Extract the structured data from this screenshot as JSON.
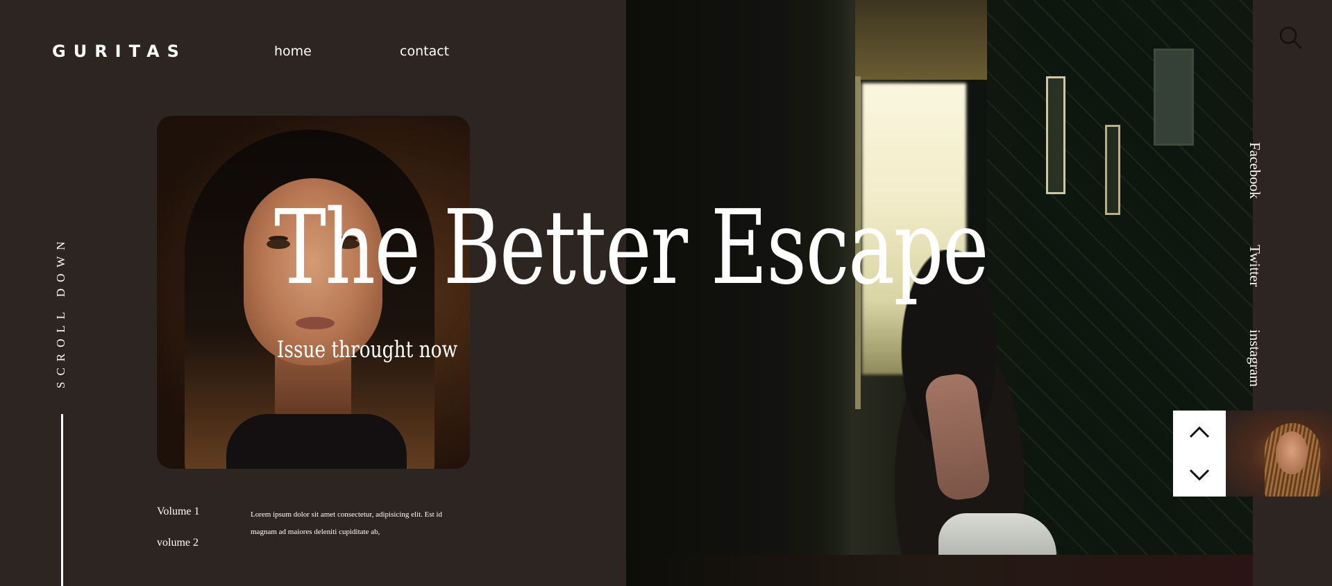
{
  "header": {
    "logo": "GURITAS",
    "nav": [
      {
        "label": "home"
      },
      {
        "label": "contact"
      }
    ]
  },
  "hero": {
    "title": "The Better Escape",
    "subtitle": "Issue throught now"
  },
  "scroll": {
    "label": "SCROLL DOWN"
  },
  "volumes": [
    {
      "label": "Volume 1"
    },
    {
      "label": "volume 2"
    }
  ],
  "description": "Lorem ipsum dolor sit amet consectetur, adipisicing elit. Est id magnam ad maiores deleniti cupiditate ab,",
  "social": [
    {
      "label": "Facebook"
    },
    {
      "label": "Twitter"
    },
    {
      "label": "instagram"
    }
  ],
  "icons": {
    "search": "search-icon",
    "up": "chevron-up-icon",
    "down": "chevron-down-icon"
  },
  "colors": {
    "background": "#2d2522",
    "text": "#ffffff",
    "control_bg": "#ffffff"
  }
}
